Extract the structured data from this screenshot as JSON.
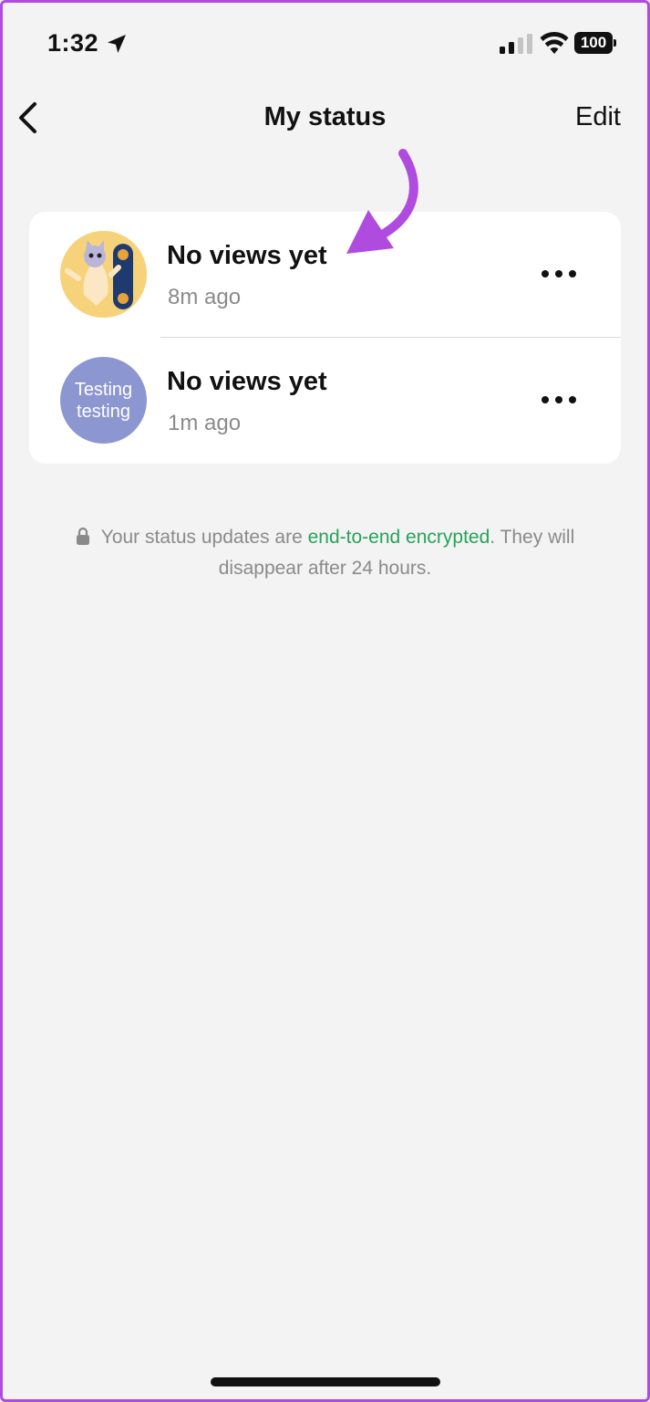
{
  "status_bar": {
    "time": "1:32",
    "battery": "100"
  },
  "nav": {
    "title": "My status",
    "edit_label": "Edit"
  },
  "statuses": [
    {
      "title": "No views yet",
      "time": "8m ago",
      "avatar": "image"
    },
    {
      "title": "No views yet",
      "time": "1m ago",
      "avatar_text_line1": "Testing",
      "avatar_text_line2": "testing",
      "avatar_color": "#8c97d2"
    }
  ],
  "note": {
    "prefix": "Your status updates are ",
    "link": "end-to-end encrypted",
    "suffix": ". They will disappear after 24 hours."
  },
  "colors": {
    "background": "#f3f3f3",
    "link": "#25a35a",
    "annotation_arrow": "#b04be0"
  },
  "icons": [
    "location-arrow-icon",
    "signal-icon",
    "wifi-icon",
    "battery-icon",
    "chevron-left-icon",
    "more-icon",
    "lock-icon"
  ]
}
